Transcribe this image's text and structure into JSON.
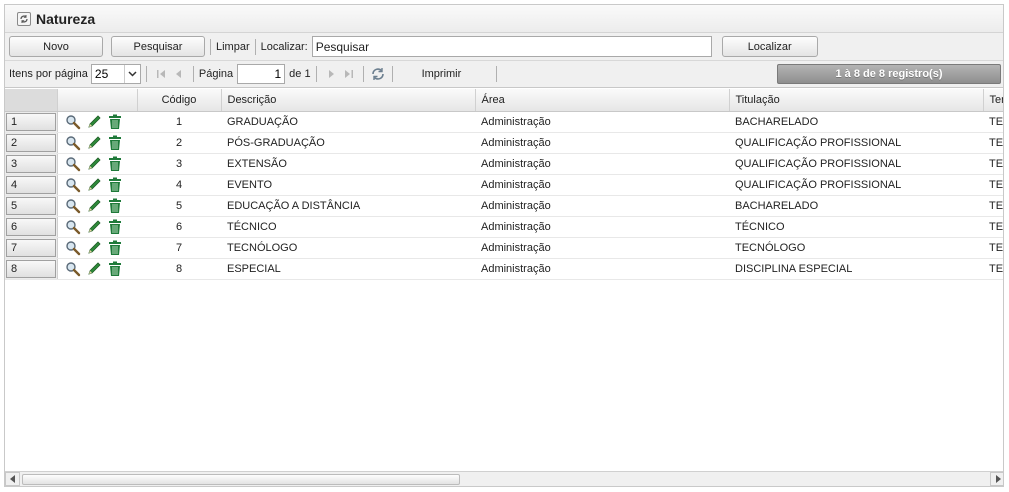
{
  "window": {
    "title": "Natureza",
    "title_icon": "refresh-icon"
  },
  "toolbar": {
    "new_label": "Novo",
    "search_label": "Pesquisar",
    "clear_label": "Limpar",
    "locate_label": "Localizar:",
    "locate_value": "Pesquisar",
    "locate_button": "Localizar"
  },
  "pager": {
    "items_per_page_label": "Itens por página",
    "items_per_page_value": "25",
    "page_label": "Página",
    "page_value": "1",
    "page_of": "de 1",
    "print_label": "Imprimir",
    "records_text": "1 à 8 de 8 registro(s)"
  },
  "grid": {
    "columns": [
      "",
      "",
      "Código",
      "Descrição",
      "Área",
      "Titulação",
      "Ter"
    ],
    "rows": [
      {
        "num": "1",
        "codigo": "1",
        "descricao": "GRADUAÇÃO",
        "area": "Administração",
        "titulacao": "BACHARELADO",
        "extra": "TE"
      },
      {
        "num": "2",
        "codigo": "2",
        "descricao": "PÓS-GRADUAÇÃO",
        "area": "Administração",
        "titulacao": "QUALIFICAÇÃO PROFISSIONAL",
        "extra": "TE"
      },
      {
        "num": "3",
        "codigo": "3",
        "descricao": "EXTENSÃO",
        "area": "Administração",
        "titulacao": "QUALIFICAÇÃO PROFISSIONAL",
        "extra": "TE"
      },
      {
        "num": "4",
        "codigo": "4",
        "descricao": "EVENTO",
        "area": "Administração",
        "titulacao": "QUALIFICAÇÃO PROFISSIONAL",
        "extra": "TE"
      },
      {
        "num": "5",
        "codigo": "5",
        "descricao": "EDUCAÇÃO A DISTÂNCIA",
        "area": "Administração",
        "titulacao": "BACHARELADO",
        "extra": "TE"
      },
      {
        "num": "6",
        "codigo": "6",
        "descricao": "TÉCNICO",
        "area": "Administração",
        "titulacao": "TÉCNICO",
        "extra": "TE"
      },
      {
        "num": "7",
        "codigo": "7",
        "descricao": "TECNÓLOGO",
        "area": "Administração",
        "titulacao": "TECNÓLOGO",
        "extra": "TE"
      },
      {
        "num": "8",
        "codigo": "8",
        "descricao": "ESPECIAL",
        "area": "Administração",
        "titulacao": "DISCIPLINA ESPECIAL",
        "extra": "TE"
      }
    ],
    "row_action_icons": [
      "magnifier-icon",
      "pencil-icon",
      "trash-icon"
    ]
  },
  "colors": {
    "records_bar": "#9e9e9e",
    "pencil": "#2e8b3a",
    "trash": "#1f7a3a"
  }
}
